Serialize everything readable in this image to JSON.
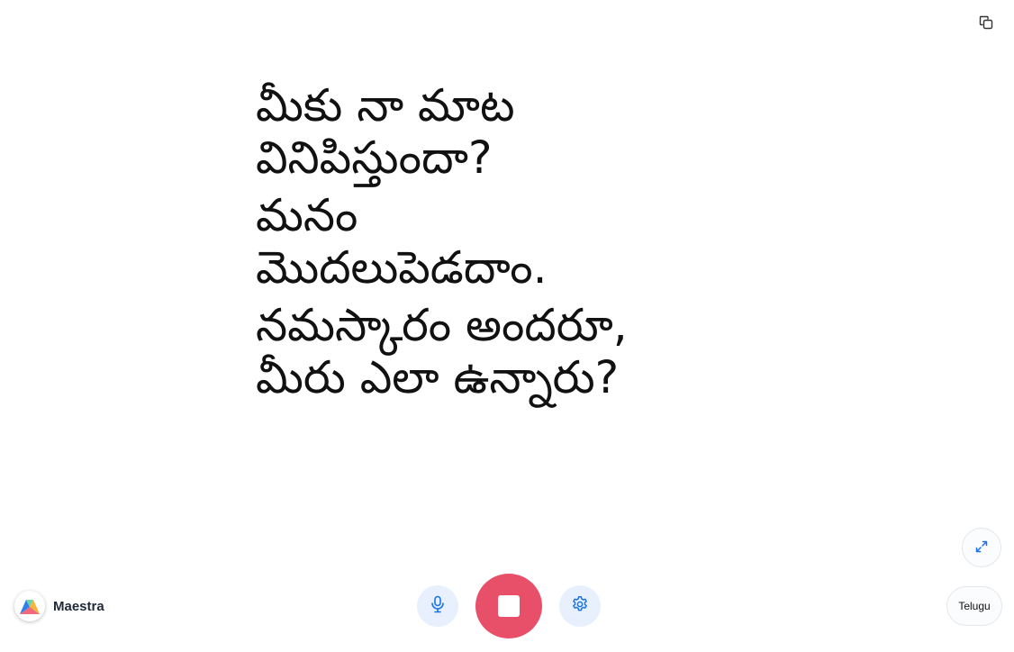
{
  "app": {
    "name": "Maestra"
  },
  "captions": [
    {
      "lines": [
        "మీకు నా మాట",
        "వినిపిస్తుందా?"
      ]
    },
    {
      "lines": [
        "మనం",
        "మొదలుపెడదాం."
      ]
    },
    {
      "lines": [
        "నమస్కారం అందరూ,",
        "మీరు ఎలా ఉన్నారు?"
      ]
    }
  ],
  "language": {
    "selected": "Telugu"
  },
  "icons": {
    "copy": "copy-icon",
    "fullscreen": "expand-icon",
    "mic": "microphone-icon",
    "stop": "stop-icon",
    "settings": "gear-icon",
    "logo": "maestra-logo"
  },
  "colors": {
    "stop": "#e8506a",
    "accent_bg": "#e8f0fe",
    "accent": "#1a73e8",
    "text": "#111111"
  }
}
